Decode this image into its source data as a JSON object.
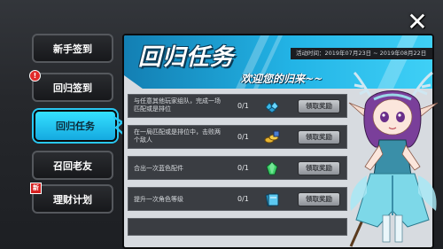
{
  "close_icon": "close-x-icon",
  "sidebar": {
    "items": [
      {
        "label": "新手签到",
        "badge": ""
      },
      {
        "label": "回归签到",
        "badge": "!"
      },
      {
        "label": "回归任务",
        "badge": "",
        "active": true
      },
      {
        "label": "召回老友",
        "badge": ""
      },
      {
        "label": "理财计划",
        "badge": "新"
      }
    ]
  },
  "panel": {
    "title": "回归任务",
    "subtitle": "欢迎您的归来~~",
    "date_range": "活动时间：2019年07月23日 ~ 2019年08月22日",
    "tasks": [
      {
        "desc": "与任意其他玩家组队，完成一场匹配或是排位",
        "progress": "0/1",
        "reward_icon": "gem-pile-icon",
        "button": "领取奖励"
      },
      {
        "desc": "在一局匹配或是排位中，击败两个敌人",
        "progress": "0/1",
        "reward_icon": "gold-coins-icon",
        "button": "领取奖励"
      },
      {
        "desc": "合出一次蓝色配件",
        "progress": "0/1",
        "reward_icon": "green-crystal-icon",
        "button": "领取奖励"
      },
      {
        "desc": "提升一次角色等级",
        "progress": "0/1",
        "reward_icon": "card-pack-icon",
        "button": "领取奖励"
      }
    ]
  },
  "colors": {
    "accent": "#29c7f2",
    "banner": "#23b4e6",
    "panel_bg": "#d7dbe0",
    "task_bg": "#3a3d42"
  }
}
